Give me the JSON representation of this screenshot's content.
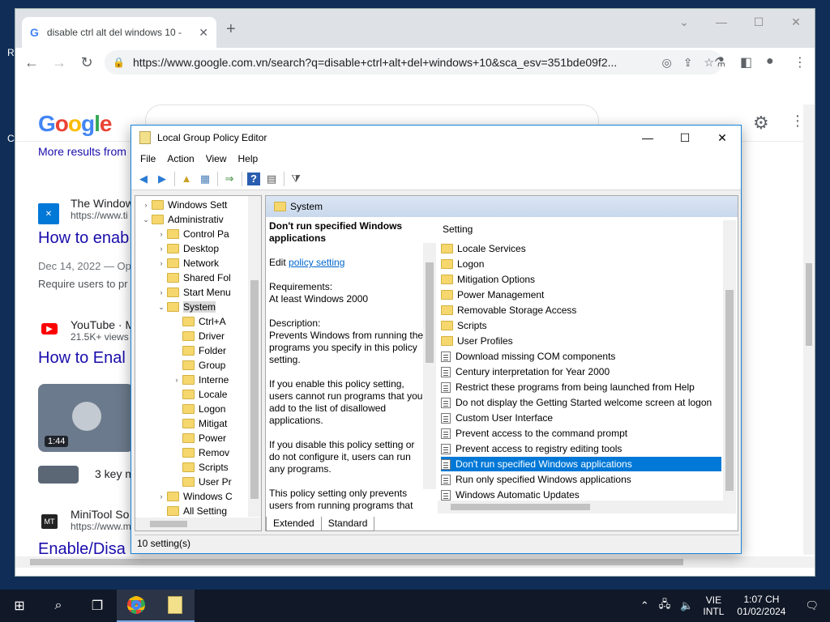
{
  "browser": {
    "tab_title": "disable ctrl alt del windows 10 -",
    "tab_favicon": "G",
    "new_tab": "+",
    "url": "https://www.google.com.vn/search?q=disable+ctrl+alt+del+windows+10&sca_esv=351bde09f2...",
    "search_query": "disable ctrl alt del windows 10"
  },
  "google": {
    "more_results": "More results from",
    "results": [
      {
        "site": "The Window",
        "url": "https://www.ti",
        "title": "How to enab",
        "meta": "Dec 14, 2022 — Op",
        "snippet": "Require users to pr"
      },
      {
        "site": "YouTube · M",
        "url": "21.5K+ views",
        "title": "How to Enal"
      },
      {
        "site": "MiniTool So",
        "url": "https://www.m",
        "title": "Enable/Disa"
      }
    ],
    "video_duration": "1:44",
    "video_more": "3 key m",
    "minitool_badge": "MT"
  },
  "gpe": {
    "title": "Local Group Policy Editor",
    "menu": [
      "File",
      "Action",
      "View",
      "Help"
    ],
    "tree": [
      {
        "label": "Windows Sett",
        "indent": 1,
        "exp": "›"
      },
      {
        "label": "Administrativ",
        "indent": 1,
        "exp": "⌄"
      },
      {
        "label": "Control Pa",
        "indent": 2,
        "exp": "›"
      },
      {
        "label": "Desktop",
        "indent": 2,
        "exp": "›"
      },
      {
        "label": "Network",
        "indent": 2,
        "exp": "›"
      },
      {
        "label": "Shared Fol",
        "indent": 2,
        "exp": ""
      },
      {
        "label": "Start Menu",
        "indent": 2,
        "exp": "›"
      },
      {
        "label": "System",
        "indent": 2,
        "exp": "⌄",
        "selected": true
      },
      {
        "label": "Ctrl+A",
        "indent": 3,
        "exp": ""
      },
      {
        "label": "Driver",
        "indent": 3,
        "exp": ""
      },
      {
        "label": "Folder",
        "indent": 3,
        "exp": ""
      },
      {
        "label": "Group",
        "indent": 3,
        "exp": ""
      },
      {
        "label": "Interne",
        "indent": 3,
        "exp": "›"
      },
      {
        "label": "Locale",
        "indent": 3,
        "exp": ""
      },
      {
        "label": "Logon",
        "indent": 3,
        "exp": ""
      },
      {
        "label": "Mitigat",
        "indent": 3,
        "exp": ""
      },
      {
        "label": "Power",
        "indent": 3,
        "exp": ""
      },
      {
        "label": "Remov",
        "indent": 3,
        "exp": ""
      },
      {
        "label": "Scripts",
        "indent": 3,
        "exp": ""
      },
      {
        "label": "User Pr",
        "indent": 3,
        "exp": ""
      },
      {
        "label": "Windows C",
        "indent": 2,
        "exp": "›"
      },
      {
        "label": "All Setting",
        "indent": 2,
        "exp": ""
      }
    ],
    "folder_header": "System",
    "desc": {
      "heading": "Don't run specified Windows applications",
      "edit_prefix": "Edit",
      "edit_link": "policy setting",
      "requirements_label": "Requirements:",
      "requirements": "At least Windows 2000",
      "description_label": "Description:",
      "p1": "Prevents Windows from running the programs you specify in this policy setting.",
      "p2": "If you enable this policy setting, users cannot run programs that you add to the list of disallowed applications.",
      "p3": "If you disable this policy setting or do not configure it, users can run any programs.",
      "p4": "This policy setting only prevents users from running programs that"
    },
    "list_header": "Setting",
    "list": [
      {
        "label": "Locale Services",
        "kind": "folder"
      },
      {
        "label": "Logon",
        "kind": "folder"
      },
      {
        "label": "Mitigation Options",
        "kind": "folder"
      },
      {
        "label": "Power Management",
        "kind": "folder"
      },
      {
        "label": "Removable Storage Access",
        "kind": "folder"
      },
      {
        "label": "Scripts",
        "kind": "folder"
      },
      {
        "label": "User Profiles",
        "kind": "folder"
      },
      {
        "label": "Download missing COM components",
        "kind": "setting"
      },
      {
        "label": "Century interpretation for Year 2000",
        "kind": "setting"
      },
      {
        "label": "Restrict these programs from being launched from Help",
        "kind": "setting"
      },
      {
        "label": "Do not display the Getting Started welcome screen at logon",
        "kind": "setting"
      },
      {
        "label": "Custom User Interface",
        "kind": "setting"
      },
      {
        "label": "Prevent access to the command prompt",
        "kind": "setting"
      },
      {
        "label": "Prevent access to registry editing tools",
        "kind": "setting"
      },
      {
        "label": "Don't run specified Windows applications",
        "kind": "setting",
        "selected": true
      },
      {
        "label": "Run only specified Windows applications",
        "kind": "setting"
      },
      {
        "label": "Windows Automatic Updates",
        "kind": "setting"
      }
    ],
    "tabs": [
      "Extended",
      "Standard"
    ],
    "status": "10 setting(s)"
  },
  "taskbar": {
    "lang_top": "VIE",
    "lang_bottom": "INTL",
    "time": "1:07 CH",
    "date": "01/02/2024"
  },
  "desktop_glyphs": [
    "R",
    "C"
  ]
}
